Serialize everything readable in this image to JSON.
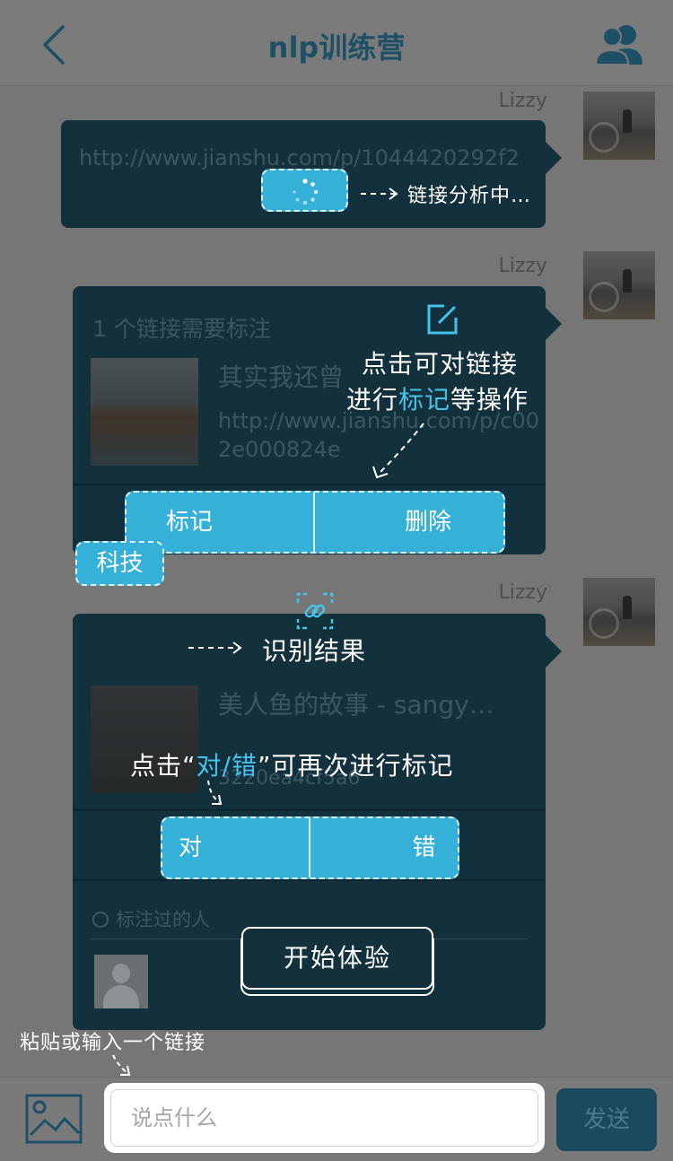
{
  "header": {
    "title": "nlp训练营",
    "back_icon": "chevron-left-icon",
    "contacts_icon": "people-icon"
  },
  "messages": [
    {
      "sender": "Lizzy",
      "url": "http://www.jianshu.com/p/1044420292f2",
      "status_tip": "链接分析中…"
    },
    {
      "sender": "Lizzy",
      "note": "1 个链接需要标注",
      "card_title": "其实我还曾",
      "card_url": "http://www.jianshu.com/p/c002e000824e",
      "mark_button": "标记",
      "delete_button": "删除",
      "tip_line1": "点击可对链接",
      "tip_line2_pre": "进行",
      "tip_line2_hl": "标记",
      "tip_line2_post": "等操作"
    },
    {
      "sender": "Lizzy",
      "tag": "科技",
      "tag_tip": "识别结果",
      "card_title": "美人鱼的故事 - sangy…",
      "card_url_tail": "3220ea4cf5a6",
      "tip_pre": "点击“",
      "tip_hl": "对/错",
      "tip_post": "”可再次进行标记",
      "right_button": "对",
      "wrong_button": "错",
      "marked_by_label": "标注过的人"
    }
  ],
  "start_button": "开始体验",
  "input_tip": "粘贴或输入一个链接",
  "composer": {
    "placeholder": "说点什么",
    "send_label": "发送",
    "image_icon": "image-icon"
  },
  "colors": {
    "accent": "#35b0d8",
    "highlight_text": "#46c3ec",
    "bubble": "#13303d",
    "overlay": "#767676"
  }
}
